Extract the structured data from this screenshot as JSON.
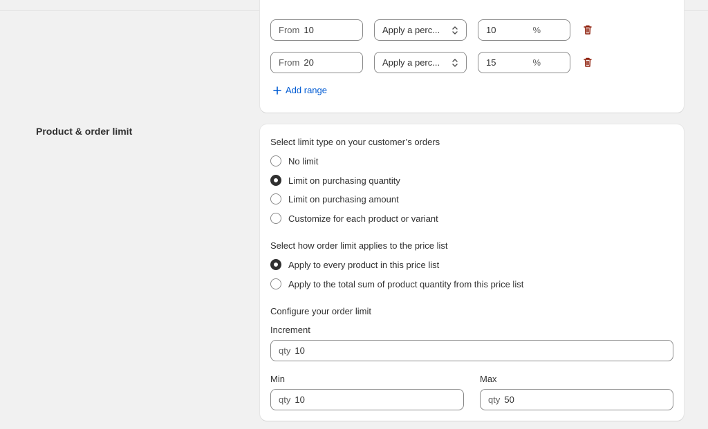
{
  "ranges": [
    {
      "from_prefix": "From",
      "from_value": "10",
      "adjustment": "Apply a perc...",
      "amount": "10",
      "unit": "%"
    },
    {
      "from_prefix": "From",
      "from_value": "20",
      "adjustment": "Apply a perc...",
      "amount": "15",
      "unit": "%"
    }
  ],
  "add_range_label": "Add range",
  "limit_section": {
    "title": "Product & order limit",
    "limit_type_label": "Select limit type on your customer’s orders",
    "limit_type_options": [
      {
        "label": "No limit",
        "selected": false
      },
      {
        "label": "Limit on purchasing quantity",
        "selected": true
      },
      {
        "label": "Limit on purchasing amount",
        "selected": false
      },
      {
        "label": "Customize for each product or variant",
        "selected": false
      }
    ],
    "apply_label": "Select how order limit applies to the price list",
    "apply_options": [
      {
        "label": "Apply to every product in this price list",
        "selected": true
      },
      {
        "label": "Apply to the total sum of product quantity from this price list",
        "selected": false
      }
    ],
    "configure_label": "Configure your order limit",
    "increment": {
      "label": "Increment",
      "prefix": "qty",
      "value": "10"
    },
    "min": {
      "label": "Min",
      "prefix": "qty",
      "value": "10"
    },
    "max": {
      "label": "Max",
      "prefix": "qty",
      "value": "50"
    }
  },
  "colors": {
    "link": "#005bd3",
    "danger": "#8e1f0b",
    "text": "#303030"
  }
}
